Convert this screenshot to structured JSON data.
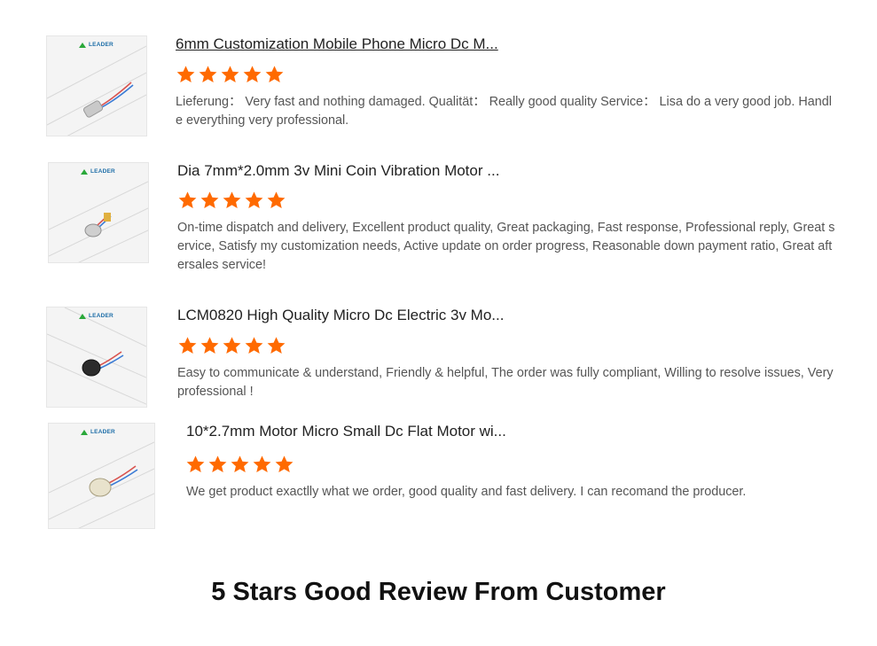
{
  "reviews": [
    {
      "brand": "LEADER",
      "title": "6mm Customization Mobile Phone Micro Dc M...",
      "rating": 5,
      "text": "Lieferung： Very fast and nothing damaged. Qualität：  Really good quality Service：  Lisa do a very good job. Handle everything very professional.",
      "thumb_icon": "cylinder-motor-image"
    },
    {
      "brand": "LEADER",
      "title": "Dia 7mm*2.0mm 3v Mini Coin Vibration Motor ...",
      "rating": 5,
      "text": "On-time dispatch and delivery, Excellent product quality, Great packaging, Fast response, Professional reply, Great service, Satisfy my customization needs, Active update on order progress, Reasonable down payment ratio, Great aftersales service!",
      "thumb_icon": "coin-motor-image"
    },
    {
      "brand": "LEADER",
      "title": "LCM0820 High Quality Micro Dc Electric 3v Mo...",
      "rating": 5,
      "text": "Easy to communicate & understand, Friendly & helpful, The order was fully compliant, Willing to resolve issues, Very professional !",
      "thumb_icon": "coin-motor-black-image"
    },
    {
      "brand": "LEADER",
      "title": "10*2.7mm Motor Micro Small Dc Flat Motor wi...",
      "rating": 5,
      "text": "We get product exactlly what we order, good quality and fast delivery. I can recomand the producer.",
      "thumb_icon": "flat-motor-image"
    }
  ],
  "caption": "5 Stars Good Review From Customer",
  "colors": {
    "star": "#ff6a00",
    "brand": "#1e6ea8",
    "logo": "#2aa83a"
  }
}
